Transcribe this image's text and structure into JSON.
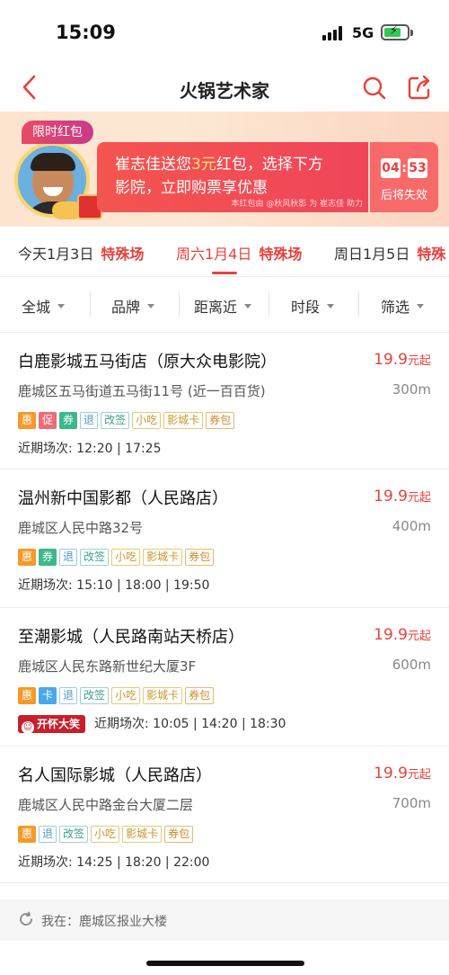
{
  "status_bar": {
    "time": "15:09",
    "network": "5G",
    "icons": [
      "signal-icon",
      "battery-charging-icon"
    ]
  },
  "nav": {
    "title": "火锅艺术家",
    "icons": [
      "back-arrow-icon",
      "search-icon",
      "share-icon"
    ]
  },
  "promo": {
    "tag": "限时红包",
    "line1_prefix": "崔志佳送您",
    "amount": "3元",
    "line1_suffix": "红包，选择下方",
    "line2": "影院，立即购票享优惠",
    "note": "本红包由 @秋风秋影 为 崔志佳 助力",
    "timer_min": "04",
    "timer_sep": ":",
    "timer_sec": "53",
    "timer_label": "后将失效",
    "colors": {
      "accent": "#f0455a",
      "amount": "#ffe27a"
    }
  },
  "date_tabs": [
    {
      "day": "今天1月3日",
      "special": "特殊场"
    },
    {
      "day": "周六1月4日",
      "special": "特殊场"
    },
    {
      "day": "周日1月5日",
      "special": "特殊"
    }
  ],
  "active_tab": 1,
  "filters": [
    "全城",
    "品牌",
    "距离近",
    "时段",
    "筛选"
  ],
  "cinemas": [
    {
      "name": "白鹿影城五马街店（原大众电影院）",
      "price": "19.9",
      "price_unit": "元起",
      "address": "鹿城区五马街道五马街11号 (近一百百货)",
      "distance": "300m",
      "tags": [
        "惠",
        "促",
        "券",
        "退",
        "改签",
        "小吃",
        "影城卡",
        "券包"
      ],
      "showtimes": "近期场次: 12:20 | 17:25"
    },
    {
      "name": "温州新中国影都（人民路店）",
      "price": "19.9",
      "price_unit": "元起",
      "address": "鹿城区人民中路32号",
      "distance": "400m",
      "tags": [
        "惠",
        "券",
        "退",
        "改签",
        "小吃",
        "影城卡",
        "券包"
      ],
      "showtimes": "近期场次: 15:10 | 18:00 | 19:50"
    },
    {
      "name": "至潮影城（人民路南站天桥店）",
      "price": "19.9",
      "price_unit": "元起",
      "address": "鹿城区人民东路新世纪大厦3F",
      "distance": "600m",
      "tags": [
        "惠",
        "卡",
        "退",
        "改签",
        "小吃",
        "影城卡",
        "券包"
      ],
      "badge": "开怀大笑",
      "showtimes": "近期场次: 10:05 | 14:20 | 18:30"
    },
    {
      "name": "名人国际影城（人民路店）",
      "price": "19.9",
      "price_unit": "元起",
      "address": "鹿城区人民中路金台大厦二层",
      "distance": "700m",
      "tags": [
        "惠",
        "退",
        "改签",
        "小吃",
        "影城卡",
        "券包"
      ],
      "showtimes": "近期场次: 14:25 | 18:20 | 22:00"
    }
  ],
  "location": {
    "label": "我在：鹿城区报业大楼",
    "icon": "refresh-icon"
  }
}
